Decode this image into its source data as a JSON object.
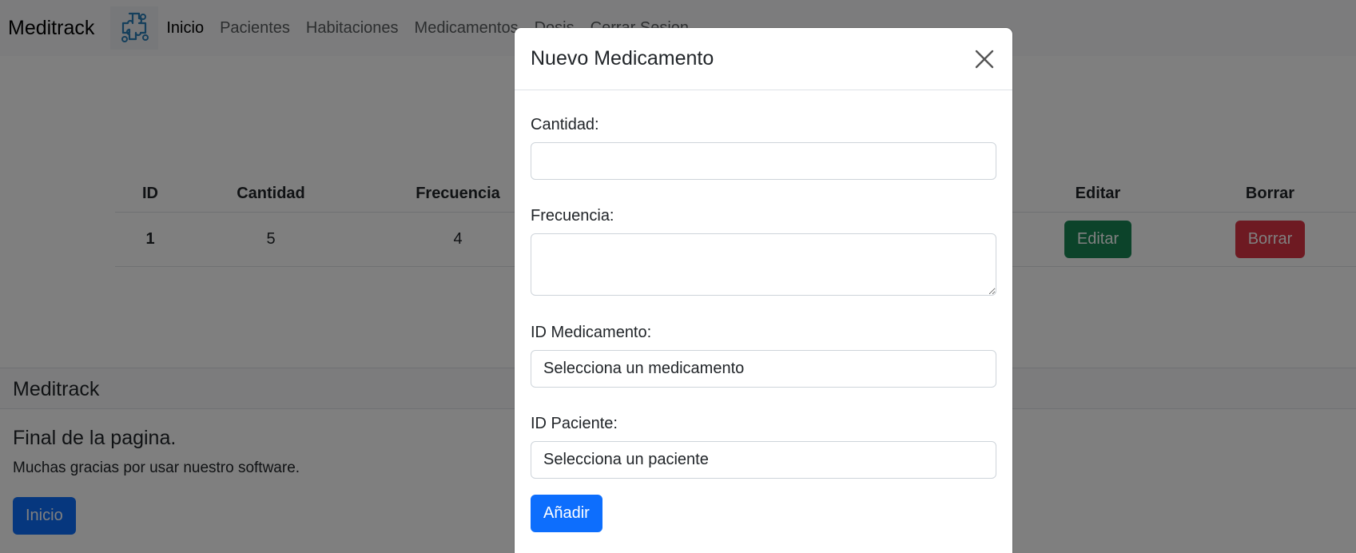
{
  "navbar": {
    "brand": "Meditrack",
    "logo_icon": "circuit-cross-logo-icon",
    "links": [
      "Inicio",
      "Pacientes",
      "Habitaciones",
      "Medicamentos",
      "Dosis",
      "Cerrar Sesion"
    ]
  },
  "table": {
    "headers": {
      "id": "ID",
      "cantidad": "Cantidad",
      "frecuencia": "Frecuencia",
      "editar": "Editar",
      "borrar": "Borrar"
    },
    "rows": [
      {
        "id": "1",
        "cantidad": "5",
        "frecuencia": "4",
        "edit_label": "Editar",
        "delete_label": "Borrar"
      }
    ]
  },
  "footer": {
    "brand": "Meditrack",
    "title": "Final de la pagina.",
    "text": "Muchas gracias por usar nuestro software.",
    "button": "Inicio"
  },
  "modal": {
    "title": "Nuevo Medicamento",
    "close_icon": "close-icon",
    "fields": {
      "cantidad_label": "Cantidad:",
      "cantidad_value": "",
      "frecuencia_label": "Frecuencia:",
      "frecuencia_value": "",
      "medicamento_label": "ID Medicamento:",
      "medicamento_selected": "Selecciona un medicamento",
      "paciente_label": "ID Paciente:",
      "paciente_selected": "Selecciona un paciente"
    },
    "submit": "Añadir"
  },
  "colors": {
    "primary": "#0d6efd",
    "success": "#198754",
    "danger": "#dc3545",
    "logo": "#2a7fb8"
  }
}
